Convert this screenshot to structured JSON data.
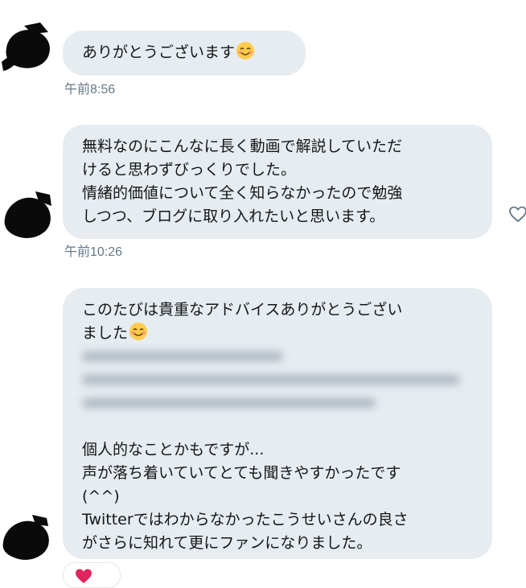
{
  "conversation": {
    "messages": [
      {
        "lines": [
          "ありがとうございます"
        ],
        "emoji": "smiling-face-emoji",
        "timestamp": "午前8:56"
      },
      {
        "lines": [
          "無料なのにこんなに長く動画で解説していただ",
          "けると思わずびっくりでした。",
          "情緒的価値について全く知らなかったので勉強",
          "しつつ、ブログに取り入れたいと思います。"
        ],
        "timestamp": "午前10:26"
      },
      {
        "lines_top": [
          "このたびは貴重なアドバイスありがとうござい",
          "ました"
        ],
        "emoji": "smiling-face-emoji",
        "lines_bottom": [
          "個人的なことかもですが...",
          "声が落ち着いていてとても聞きやすかったです",
          "(^^)",
          "Twitterではわからなかったこうせいさんの良さ",
          "がさらに知れて更にファンになりました。"
        ]
      }
    ],
    "icons": {
      "like": "heart-outline-icon",
      "reaction": "heart-reaction-icon",
      "avatar": "redacted-avatar"
    },
    "colors": {
      "bubble": "#e6ecf0",
      "text": "#14171a",
      "timestamp": "#657786",
      "reaction_heart": "#e0245e"
    }
  }
}
